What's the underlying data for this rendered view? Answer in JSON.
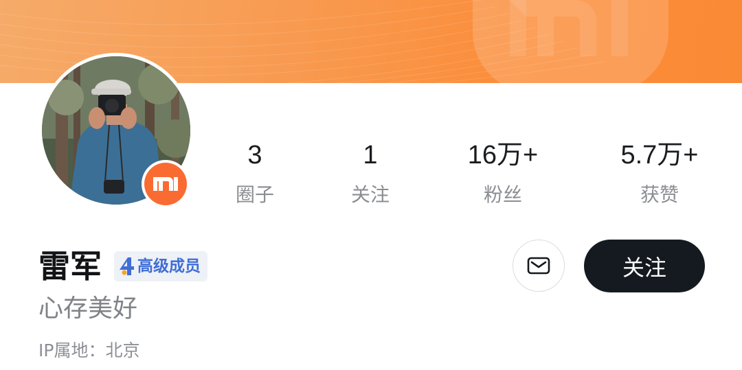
{
  "banner": {
    "accent_color": "#fb8d3a",
    "logo_icon": "mi-logo-icon"
  },
  "profile": {
    "avatar_icon": "user-avatar",
    "brand_badge_icon": "mi-badge-icon",
    "brand_badge_text": "MI",
    "brand_color": "#fa6b32",
    "name": "雷军",
    "level_badge": {
      "label": "高级成员",
      "icon": "level-4-icon",
      "level": "4",
      "color": "#3f6ed6"
    },
    "bio": "心存美好",
    "ip_location": "IP属地：北京"
  },
  "stats": [
    {
      "value": "3",
      "label": "圈子"
    },
    {
      "value": "1",
      "label": "关注"
    },
    {
      "value": "16万+",
      "label": "粉丝"
    },
    {
      "value": "5.7万+",
      "label": "获赞"
    }
  ],
  "actions": {
    "message_icon": "mail-icon",
    "follow_label": "关注",
    "follow_color": "#141a20"
  }
}
